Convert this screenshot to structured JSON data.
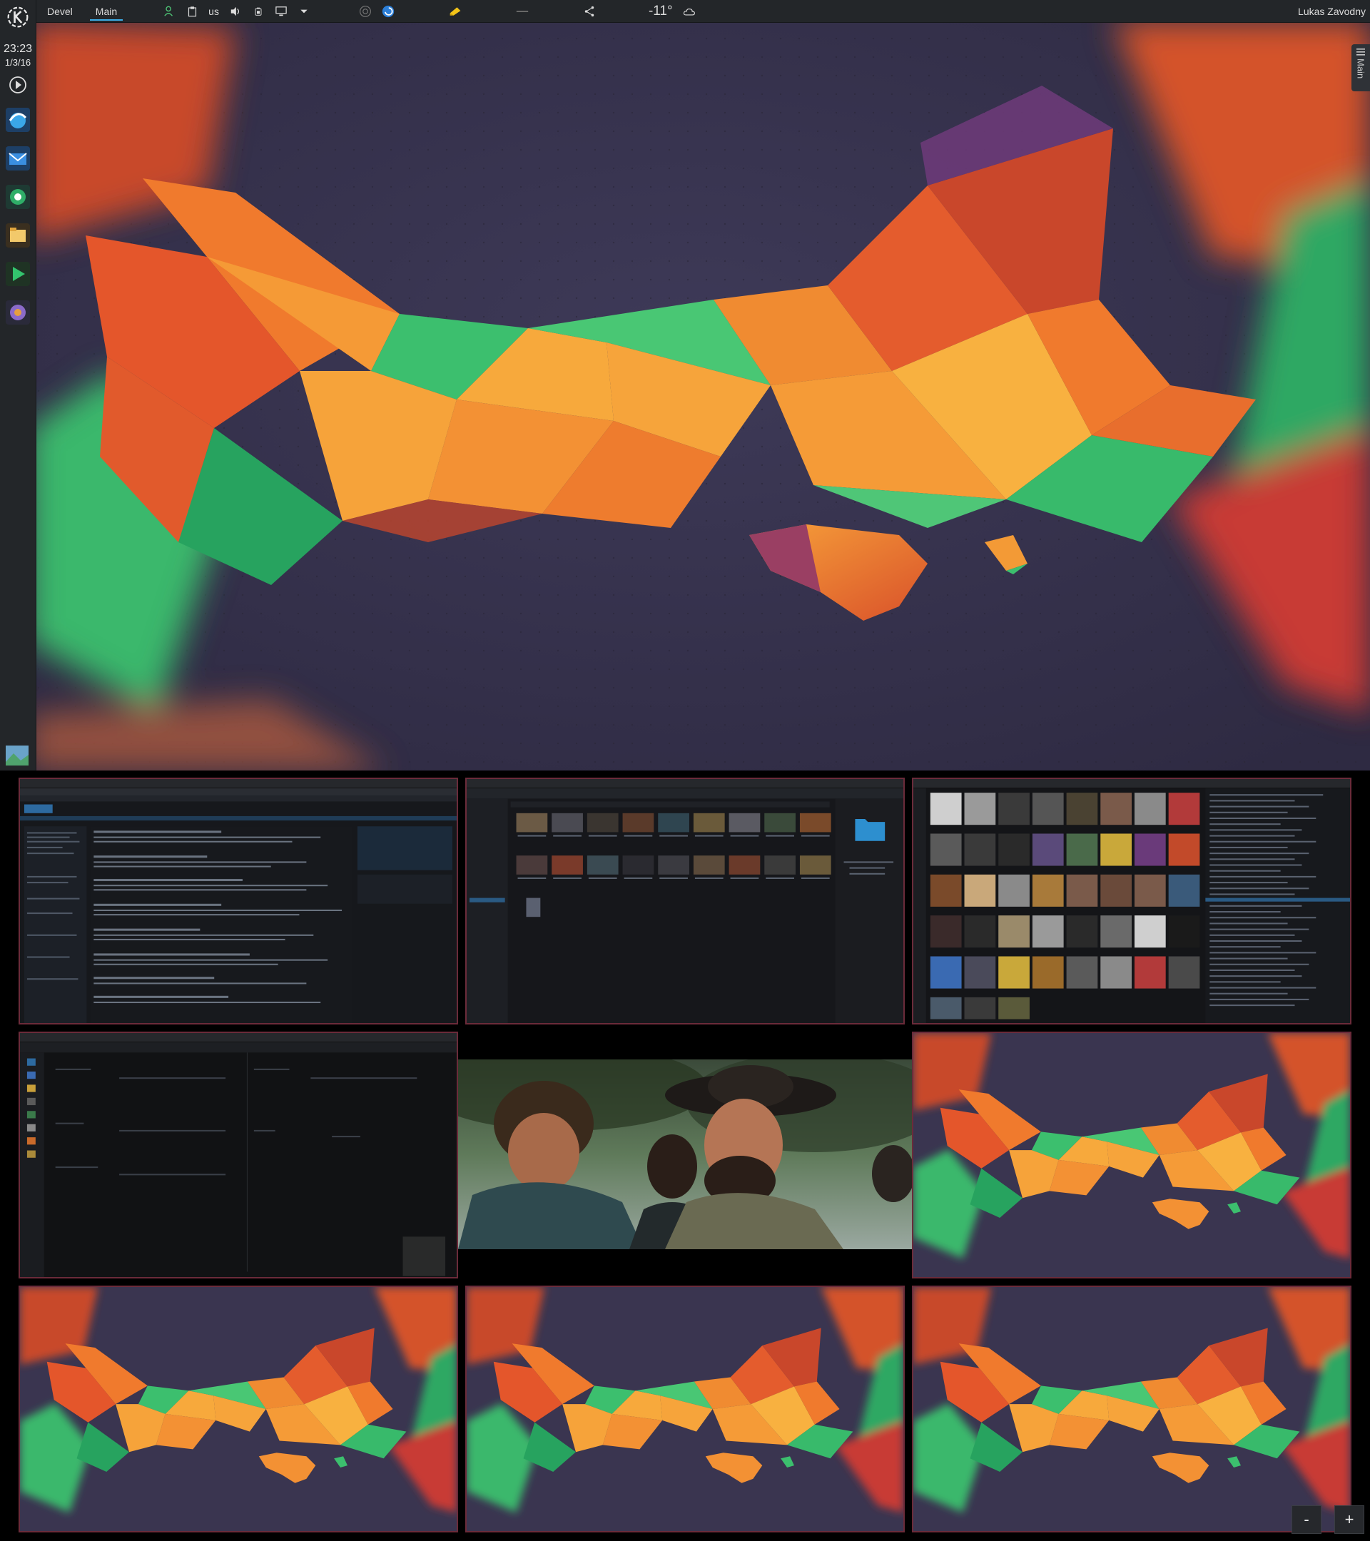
{
  "topbar": {
    "activities": [
      "Devel",
      "Main"
    ],
    "active_activity": "Main",
    "keyboard_layout": "us",
    "temperature": "-11°",
    "user": "Lukas Zavodny",
    "icons": [
      "user-status-icon",
      "clipboard-icon",
      "volume-icon",
      "battery-icon",
      "display-icon",
      "dropdown-arrow-icon",
      "kdeconnect-icon",
      "browser-icon",
      "notes-icon",
      "network-icon",
      "share-icon",
      "cloud-icon"
    ]
  },
  "leftpanel": {
    "time": "23:23",
    "date": "1/3/16",
    "launchers": [
      "media-play-icon",
      "browser-launcher-icon",
      "mail-launcher-icon",
      "chat-launcher-icon",
      "files-launcher-icon",
      "media-player-launcher-icon",
      "music-launcher-icon"
    ]
  },
  "sidetab": {
    "label": "Main"
  },
  "workspaces": {
    "tiles": [
      {
        "name": "web-browser-window",
        "kind": "browser"
      },
      {
        "name": "file-manager-window",
        "kind": "files"
      },
      {
        "name": "music-player-window",
        "kind": "music"
      },
      {
        "name": "dark-app-window",
        "kind": "dark"
      },
      {
        "name": "video-window",
        "kind": "video"
      },
      {
        "name": "empty-desktop-6",
        "kind": "wallpaper"
      },
      {
        "name": "empty-desktop-7",
        "kind": "wallpaper"
      },
      {
        "name": "empty-desktop-8",
        "kind": "wallpaper"
      },
      {
        "name": "empty-desktop-9",
        "kind": "wallpaper"
      }
    ],
    "zoom_out_label": "-",
    "zoom_in_label": "+"
  },
  "colors": {
    "panel": "#232629",
    "accent": "#3daee9",
    "wallpaper_orange": "#f08a2a",
    "wallpaper_green": "#3fbf6f",
    "wallpaper_purple": "#3b3552"
  }
}
